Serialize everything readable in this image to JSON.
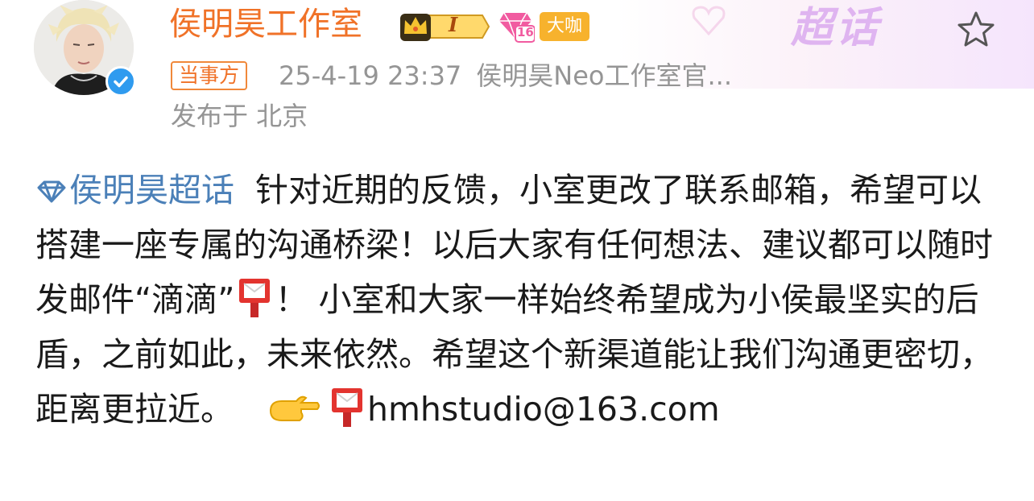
{
  "watermark": "超话",
  "author": {
    "name": "侯明昊工作室",
    "crown_badge_text": "I",
    "level_badge_text": "16",
    "big_badge": "大咖"
  },
  "meta": {
    "party_tag": "当事方",
    "timestamp": "25-4-19 23:37",
    "source": "侯明昊Neo工作室官...",
    "location": "发布于 北京"
  },
  "post": {
    "topic": "侯明昊超话",
    "text_part1": "针对近期的反馈，小室更改了联系邮箱，希望可以搭建一座专属的沟通桥梁！以后大家有任何想法、建议都可以随时发邮件“滴滴”",
    "text_part2": "！ 小室和大家一样始终希望成为小侯最坚实的后盾，之前如此，未来依然。希望这个新渠道能让我们沟通更密切，距离更拉近。",
    "email": "hmhstudio@163.com"
  },
  "icons": {
    "topic": "diamond-topic-icon",
    "mailbox": "postbox-emoji",
    "hand": "pointing-right-emoji",
    "favorite": "star-outline-icon",
    "verified": "verified-check-icon"
  },
  "colors": {
    "name": "#f07228",
    "topic_link": "#4b80b8",
    "meta_gray": "#959595",
    "verified_blue": "#2f9bef",
    "big_badge": "#f7b22d"
  }
}
